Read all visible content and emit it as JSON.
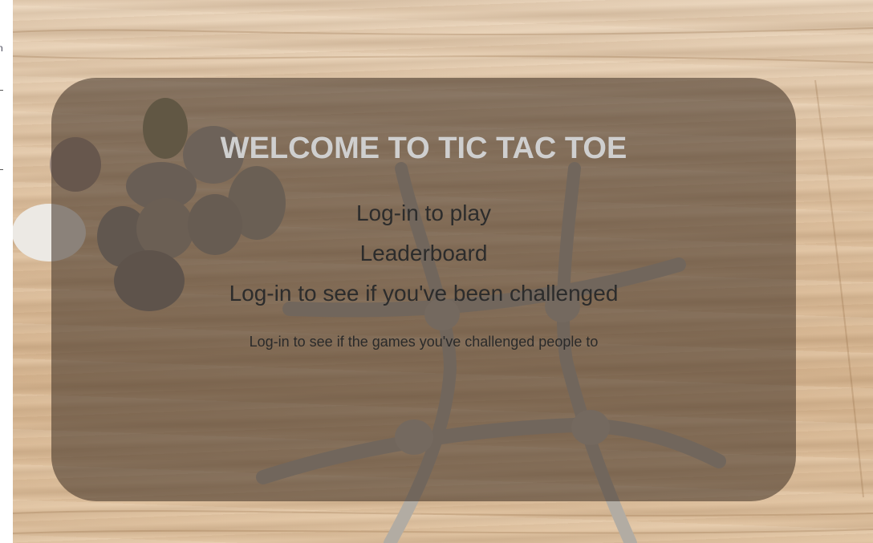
{
  "page": {
    "title": "WELCOME TO TIC TAC TOE"
  },
  "menu": {
    "login_to_play": "Log-in to play",
    "leaderboard": "Leaderboard",
    "login_challenged": "Log-in to see if you've been challenged",
    "login_sent_challenges": "Log-in to see if the games you've challenged people to"
  },
  "left_strip": {
    "glyph": "n"
  },
  "colors": {
    "overlay": "#3c2d23",
    "title": "#cfcfcf",
    "link": "#2c2c2c",
    "wood": "#e0c3a2"
  },
  "background_image": {
    "subject": "stones-and-sticks-tic-tac-toe-board-on-wood"
  }
}
